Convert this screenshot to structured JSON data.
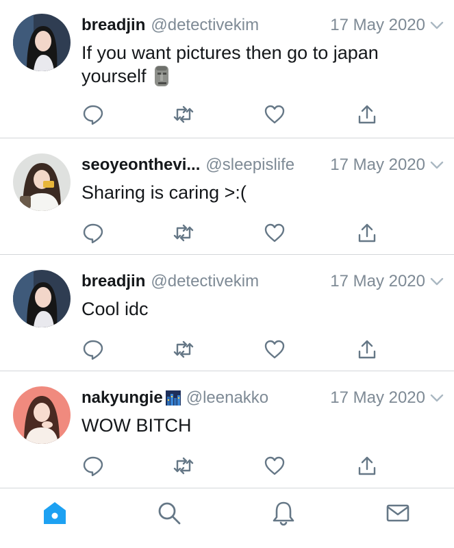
{
  "colors": {
    "accent": "#1da1f2",
    "icon_gray": "#657786",
    "text": "#14171a",
    "muted": "#7e8a95",
    "divider": "#d3d6d9"
  },
  "tweets": [
    {
      "name": "breadjin",
      "handle": "@detectivekim",
      "date": "17 May 2020",
      "text": "If you want pictures then go to japan yourself",
      "emoji": "moai"
    },
    {
      "name": "seoyeonthevi...",
      "handle": "@sleepislife",
      "date": "17 May 2020",
      "text": "Sharing is caring >:("
    },
    {
      "name": "breadjin",
      "handle": "@detectivekim",
      "date": "17 May 2020",
      "text": "Cool idc"
    },
    {
      "name": "nakyungie",
      "name_emoji": "night-city-emoji",
      "handle": "@leenakko",
      "date": "17 May 2020",
      "text": "WOW BITCH"
    }
  ],
  "actions": [
    "reply-icon",
    "retweet-icon",
    "like-icon",
    "share-icon"
  ],
  "tabbar": {
    "active": "home",
    "tabs": [
      "home-icon",
      "search-icon",
      "notifications-icon",
      "messages-icon"
    ]
  }
}
